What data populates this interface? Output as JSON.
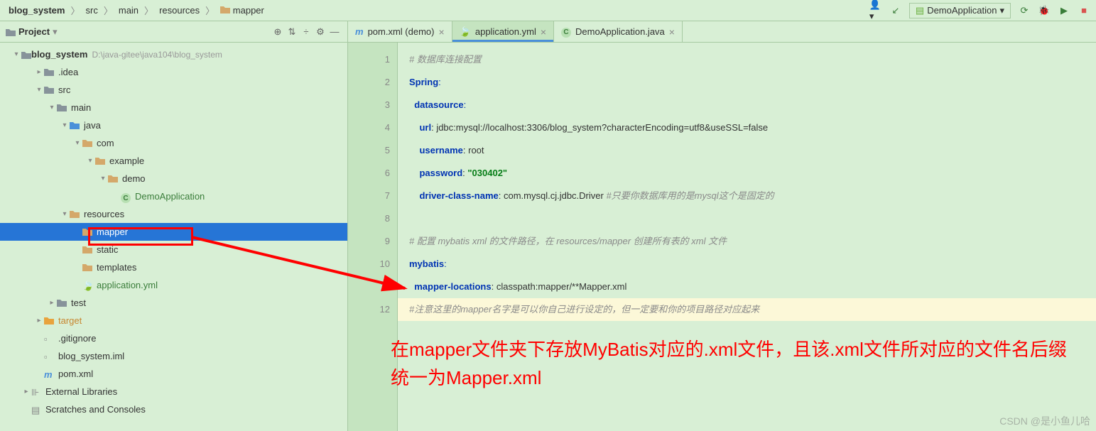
{
  "breadcrumb": [
    "blog_system",
    "src",
    "main",
    "resources",
    "mapper"
  ],
  "runConfig": "DemoApplication",
  "project": {
    "title": "Project",
    "root": {
      "label": "blog_system",
      "path": "D:\\java-gitee\\java104\\blog_system"
    },
    "tree": [
      {
        "label": ".idea",
        "depth": 1,
        "arrow": ">",
        "icon": "folder"
      },
      {
        "label": "src",
        "depth": 1,
        "arrow": "v",
        "icon": "folder"
      },
      {
        "label": "main",
        "depth": 2,
        "arrow": "v",
        "icon": "folder"
      },
      {
        "label": "java",
        "depth": 3,
        "arrow": "v",
        "icon": "folder-blue"
      },
      {
        "label": "com",
        "depth": 4,
        "arrow": "v",
        "icon": "folder-tan"
      },
      {
        "label": "example",
        "depth": 5,
        "arrow": "v",
        "icon": "folder-tan"
      },
      {
        "label": "demo",
        "depth": 6,
        "arrow": "v",
        "icon": "folder-tan"
      },
      {
        "label": "DemoApplication",
        "depth": 7,
        "arrow": "",
        "icon": "class",
        "color": "#3a7d3a"
      },
      {
        "label": "resources",
        "depth": 3,
        "arrow": "v",
        "icon": "folder-tan"
      },
      {
        "label": "mapper",
        "depth": 4,
        "arrow": "",
        "icon": "folder-tan",
        "selected": true
      },
      {
        "label": "static",
        "depth": 4,
        "arrow": "",
        "icon": "folder-tan"
      },
      {
        "label": "templates",
        "depth": 4,
        "arrow": "",
        "icon": "folder-tan"
      },
      {
        "label": "application.yml",
        "depth": 4,
        "arrow": "",
        "icon": "yml",
        "color": "#3a7d3a"
      },
      {
        "label": "test",
        "depth": 2,
        "arrow": ">",
        "icon": "folder"
      },
      {
        "label": "target",
        "depth": 1,
        "arrow": ">",
        "icon": "folder-orange",
        "color": "#c7862f"
      },
      {
        "label": ".gitignore",
        "depth": 1,
        "arrow": "",
        "icon": "file"
      },
      {
        "label": "blog_system.iml",
        "depth": 1,
        "arrow": "",
        "icon": "file"
      },
      {
        "label": "pom.xml",
        "depth": 1,
        "arrow": "",
        "icon": "m"
      },
      {
        "label": "External Libraries",
        "depth": 0,
        "arrow": ">",
        "icon": "lib"
      },
      {
        "label": "Scratches and Consoles",
        "depth": 0,
        "arrow": "",
        "icon": "scratch"
      }
    ]
  },
  "tabs": [
    {
      "label": "pom.xml (demo)",
      "icon": "m",
      "active": false
    },
    {
      "label": "application.yml",
      "icon": "yml",
      "active": true
    },
    {
      "label": "DemoApplication.java",
      "icon": "class",
      "active": false
    }
  ],
  "code": {
    "lines": [
      {
        "n": 1,
        "tokens": [
          {
            "t": "# 数据库连接配置",
            "c": "c-comment"
          }
        ]
      },
      {
        "n": 2,
        "tokens": [
          {
            "t": "Spring",
            "c": "c-key"
          },
          {
            "t": ":",
            "c": "c-colon"
          }
        ]
      },
      {
        "n": 3,
        "indent": 2,
        "tokens": [
          {
            "t": "datasource",
            "c": "c-key"
          },
          {
            "t": ":",
            "c": "c-colon"
          }
        ]
      },
      {
        "n": 4,
        "indent": 4,
        "tokens": [
          {
            "t": "url",
            "c": "c-key"
          },
          {
            "t": ": ",
            "c": ""
          },
          {
            "t": "jdbc:mysql://localhost:3306/blog_system?characterEncoding=utf8&useSSL=false",
            "c": ""
          }
        ]
      },
      {
        "n": 5,
        "indent": 4,
        "tokens": [
          {
            "t": "username",
            "c": "c-key"
          },
          {
            "t": ": ",
            "c": ""
          },
          {
            "t": "root",
            "c": ""
          }
        ]
      },
      {
        "n": 6,
        "indent": 4,
        "tokens": [
          {
            "t": "password",
            "c": "c-key"
          },
          {
            "t": ": ",
            "c": ""
          },
          {
            "t": "\"030402\"",
            "c": "c-string"
          }
        ]
      },
      {
        "n": 7,
        "indent": 4,
        "tokens": [
          {
            "t": "driver-class-name",
            "c": "c-key"
          },
          {
            "t": ": ",
            "c": ""
          },
          {
            "t": "com.mysql.cj.jdbc.Driver ",
            "c": ""
          },
          {
            "t": "#只要你数据库用的是mysql这个是固定的",
            "c": "c-comment"
          }
        ]
      },
      {
        "n": 8,
        "tokens": []
      },
      {
        "n": 9,
        "tokens": [
          {
            "t": "# 配置 mybatis xml 的文件路径，在 resources/mapper 创建所有表的 xml 文件",
            "c": "c-comment"
          }
        ]
      },
      {
        "n": 10,
        "tokens": [
          {
            "t": "mybatis",
            "c": "c-key"
          },
          {
            "t": ":",
            "c": "c-colon"
          }
        ]
      },
      {
        "n": 11,
        "indent": 2,
        "tokens": [
          {
            "t": "mapper-locations",
            "c": "c-key"
          },
          {
            "t": ": ",
            "c": ""
          },
          {
            "t": "classpath:mapper/**Mapper.xml",
            "c": ""
          }
        ]
      },
      {
        "n": 12,
        "hl": true,
        "tokens": [
          {
            "t": "#注意这里的mapper名字是可以你自己进行设定的，但一定要和你的项目路径对应起来",
            "c": "c-comment"
          }
        ]
      }
    ]
  },
  "annotation": "在mapper文件夹下存放MyBatis对应的.xml文件，且该.xml文件所对应的文件名后缀统一为Mapper.xml",
  "watermark": "CSDN @是小鱼儿哈"
}
